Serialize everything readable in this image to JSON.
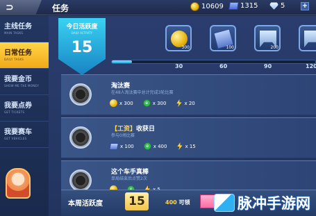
{
  "header": {
    "title": "任务",
    "currencies": [
      {
        "icon": "coin-icon",
        "value": "10609"
      },
      {
        "icon": "ticket-icon",
        "value": "1315"
      },
      {
        "icon": "gem-icon",
        "value": "5"
      }
    ],
    "plus": "+"
  },
  "sidebar": {
    "items": [
      {
        "cn": "主线任务",
        "en": "MAIN TASKS",
        "active": false
      },
      {
        "cn": "日常任务",
        "en": "DAILY TASKS",
        "active": true
      },
      {
        "cn": "我要金币",
        "en": "SHOW ME THE MONEY",
        "active": false
      },
      {
        "cn": "我要点券",
        "en": "GET TICKETS",
        "active": false
      },
      {
        "cn": "我要赛车",
        "en": "GET VEHICLES",
        "active": false
      }
    ]
  },
  "daily_activity": {
    "title": "今日活跃度",
    "subtitle": "DAILY ACTIVITY",
    "value": "15",
    "progress_fraction": 0.1
  },
  "milestones": [
    {
      "label": "30",
      "reward_icon": "coin",
      "reward_count": "300"
    },
    {
      "label": "60",
      "reward_icon": "card",
      "reward_count": "100"
    },
    {
      "label": "90",
      "reward_icon": "chip",
      "reward_count": "200"
    },
    {
      "label": "120",
      "reward_icon": "chip",
      "reward_count": ""
    }
  ],
  "tasks": [
    {
      "title": "淘汰赛",
      "tag": "",
      "desc": "在48人淘汰赛中总计完成3轮比赛",
      "rewards": [
        {
          "icon": "coin",
          "text": "x 300"
        },
        {
          "icon": "exp",
          "text": "x 300"
        },
        {
          "icon": "bolt",
          "text": "x 20"
        }
      ]
    },
    {
      "title": "收获日",
      "tag": "【工资】",
      "desc": "参与0场比赛",
      "rewards": [
        {
          "icon": "card",
          "text": "x 100"
        },
        {
          "icon": "exp",
          "text": "x 400"
        },
        {
          "icon": "bolt",
          "text": "x 15"
        }
      ]
    },
    {
      "title": "这个车手真棒",
      "tag": "",
      "desc": "单局结束后点赞2次",
      "rewards": [
        {
          "icon": "coin",
          "text": ""
        },
        {
          "icon": "exp",
          "text": ""
        },
        {
          "icon": "bolt",
          "text": "x 5"
        }
      ]
    }
  ],
  "weekly": {
    "label": "本周活跃度",
    "value": "15",
    "goal_num": "400",
    "goal_text": "可领"
  },
  "watermark": {
    "text": "脉冲手游网"
  }
}
